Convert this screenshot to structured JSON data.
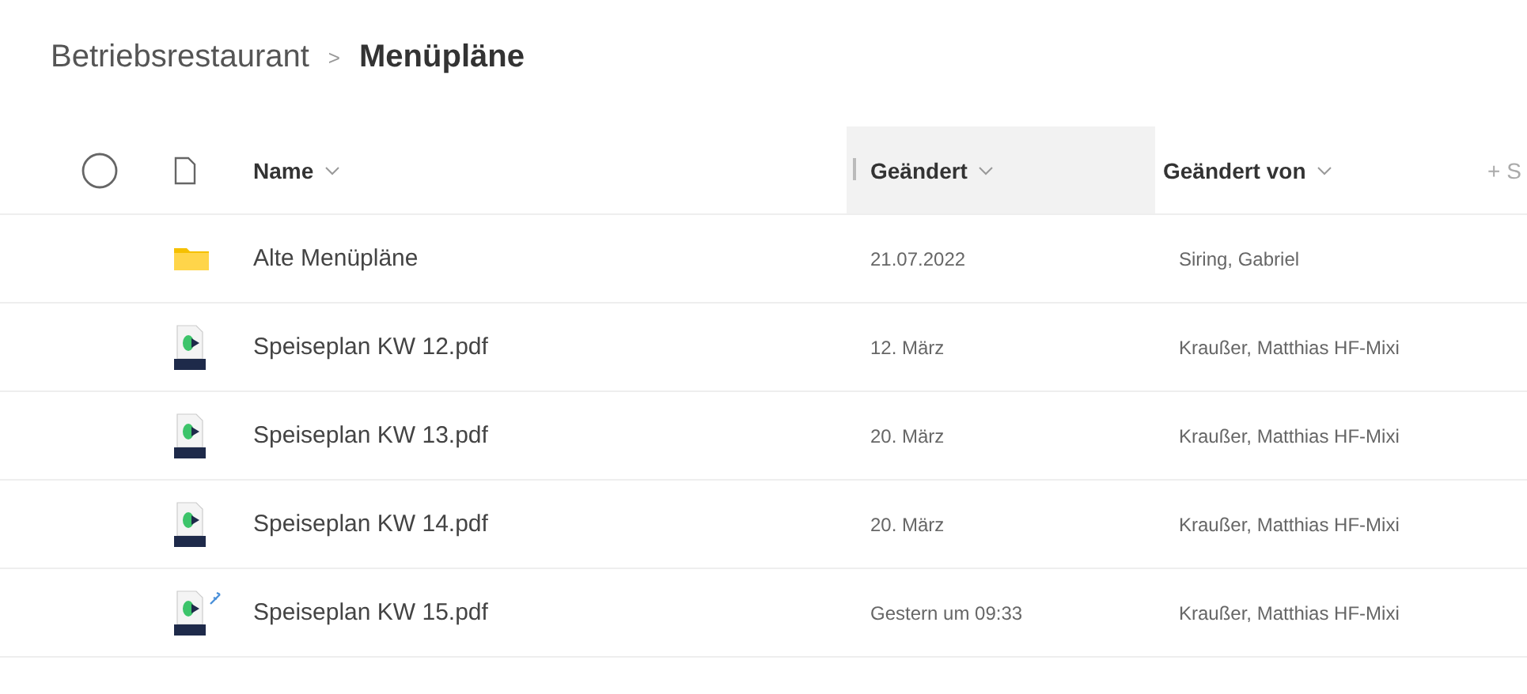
{
  "breadcrumb": {
    "parent": "Betriebsrestaurant",
    "separator": ">",
    "current": "Menüpläne"
  },
  "table": {
    "columns": [
      {
        "label": "Name",
        "sorted": false
      },
      {
        "label": "Geändert",
        "sorted": true
      },
      {
        "label": "Geändert von",
        "sorted": false
      }
    ],
    "add_column": "+ S",
    "rows": [
      {
        "kind": "folder",
        "name": "Alte Menüpläne",
        "modified": "21.07.2022",
        "modified_by": "Siring, Gabriel",
        "is_new": false
      },
      {
        "kind": "pdf",
        "name": "Speiseplan KW 12.pdf",
        "modified": "12. März",
        "modified_by": "Kraußer, Matthias HF-Mixi",
        "is_new": false
      },
      {
        "kind": "pdf",
        "name": "Speiseplan KW 13.pdf",
        "modified": "20. März",
        "modified_by": "Kraußer, Matthias HF-Mixi",
        "is_new": false
      },
      {
        "kind": "pdf",
        "name": "Speiseplan KW 14.pdf",
        "modified": "20. März",
        "modified_by": "Kraußer, Matthias HF-Mixi",
        "is_new": false
      },
      {
        "kind": "pdf",
        "name": "Speiseplan KW 15.pdf",
        "modified": "Gestern um 09:33",
        "modified_by": "Kraußer, Matthias HF-Mixi",
        "is_new": true
      }
    ]
  }
}
